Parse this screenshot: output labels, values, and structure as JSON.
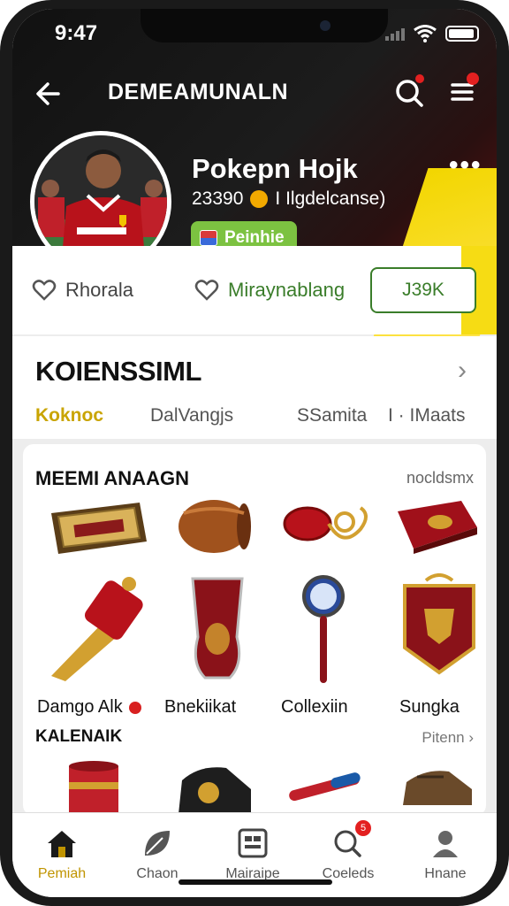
{
  "status_bar": {
    "time": "9:47"
  },
  "header": {
    "title": "DEMEAMUNALN"
  },
  "profile": {
    "name": "Pokepn Hojk",
    "points": "23390",
    "points_suffix": "I Ilgdelcanse)",
    "badge": "Peinhie"
  },
  "actions": {
    "like_label": "Rhorala",
    "favorite_label": "Miraynablang",
    "follow_label": "J39K"
  },
  "collection": {
    "title": "KOIENSSIML",
    "tabs": [
      "Koknoc",
      "DalVangjs",
      "SSamita",
      "I · IMaats"
    ]
  },
  "grid": {
    "title": "MEEMI ANAAGN",
    "link": "nocldsmx",
    "items": [
      {
        "name": "plaque-item"
      },
      {
        "name": "barrel-item"
      },
      {
        "name": "keychain-item"
      },
      {
        "name": "book-item"
      },
      {
        "name": "horn-item",
        "label": "Damgo Alk"
      },
      {
        "name": "glass-item",
        "label": "Bnekiikat"
      },
      {
        "name": "magnifier-item",
        "label": "Collexiin"
      },
      {
        "name": "banner-item",
        "label": "Sungka"
      }
    ],
    "section2_title": "KALENAIK",
    "section2_link": "Pitenn ›"
  },
  "nav": [
    {
      "label": "Pemiah",
      "icon": "home-icon",
      "active": true
    },
    {
      "label": "Chaon",
      "icon": "leaf-icon"
    },
    {
      "label": "Mairaipe",
      "icon": "grid-icon"
    },
    {
      "label": "Coeleds",
      "icon": "search-icon",
      "badge": "5"
    },
    {
      "label": "Hnane",
      "icon": "user-icon"
    }
  ],
  "colors": {
    "accent_green": "#7cc241",
    "accent_yellow": "#f2d600",
    "brand_red": "#b8121b",
    "dark_bg": "#111111"
  }
}
